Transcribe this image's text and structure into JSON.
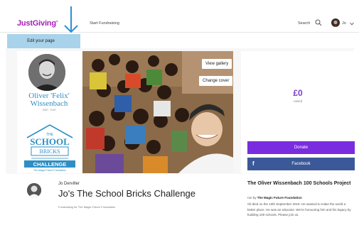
{
  "nav": {
    "logo": "JustGiving",
    "logo_tm": "®",
    "start_fundraising": "Start Fundraising",
    "search": "Search",
    "user": "Jo"
  },
  "edit_page": "Edit your page",
  "hero": {
    "name_line1": "Oliver 'Felix'",
    "name_line2": "Wissenbach",
    "dates": "2000 · 2019",
    "school_logo": {
      "the": "THE",
      "school": "SCHOOL",
      "bricks": "BRICKS",
      "challenge": "CHALLENGE",
      "sub": "The Magic Future Foundation"
    },
    "view_gallery": "View gallery",
    "change_cover": "Change cover"
  },
  "raised": {
    "amount": "£0",
    "label": "raised"
  },
  "donate": "Donate",
  "facebook": {
    "icon": "f",
    "label": "Facebook"
  },
  "owner": {
    "name": "Jo Derviller",
    "title": "Jo's The School Bricks Challenge",
    "fundraising_for": "Fundraising for The Magic Future Foundation"
  },
  "charity": {
    "title": "The Oliver Wissenbach 100 Schools Project",
    "run_by_prefix": "run by",
    "run_by_org": "The Magic Future Foundation",
    "description": "Oli died on the 10th September 2019. He wanted to make the world a better place. He was an educator. We're honouring him and his legacy by building 100 schools. Please join us."
  },
  "colors": {
    "brand": "#a620b5",
    "donate": "#7a2dde",
    "facebook": "#3b5998",
    "highlight": "#a8d3ea",
    "annotation_arrow": "#2b8fd6"
  }
}
